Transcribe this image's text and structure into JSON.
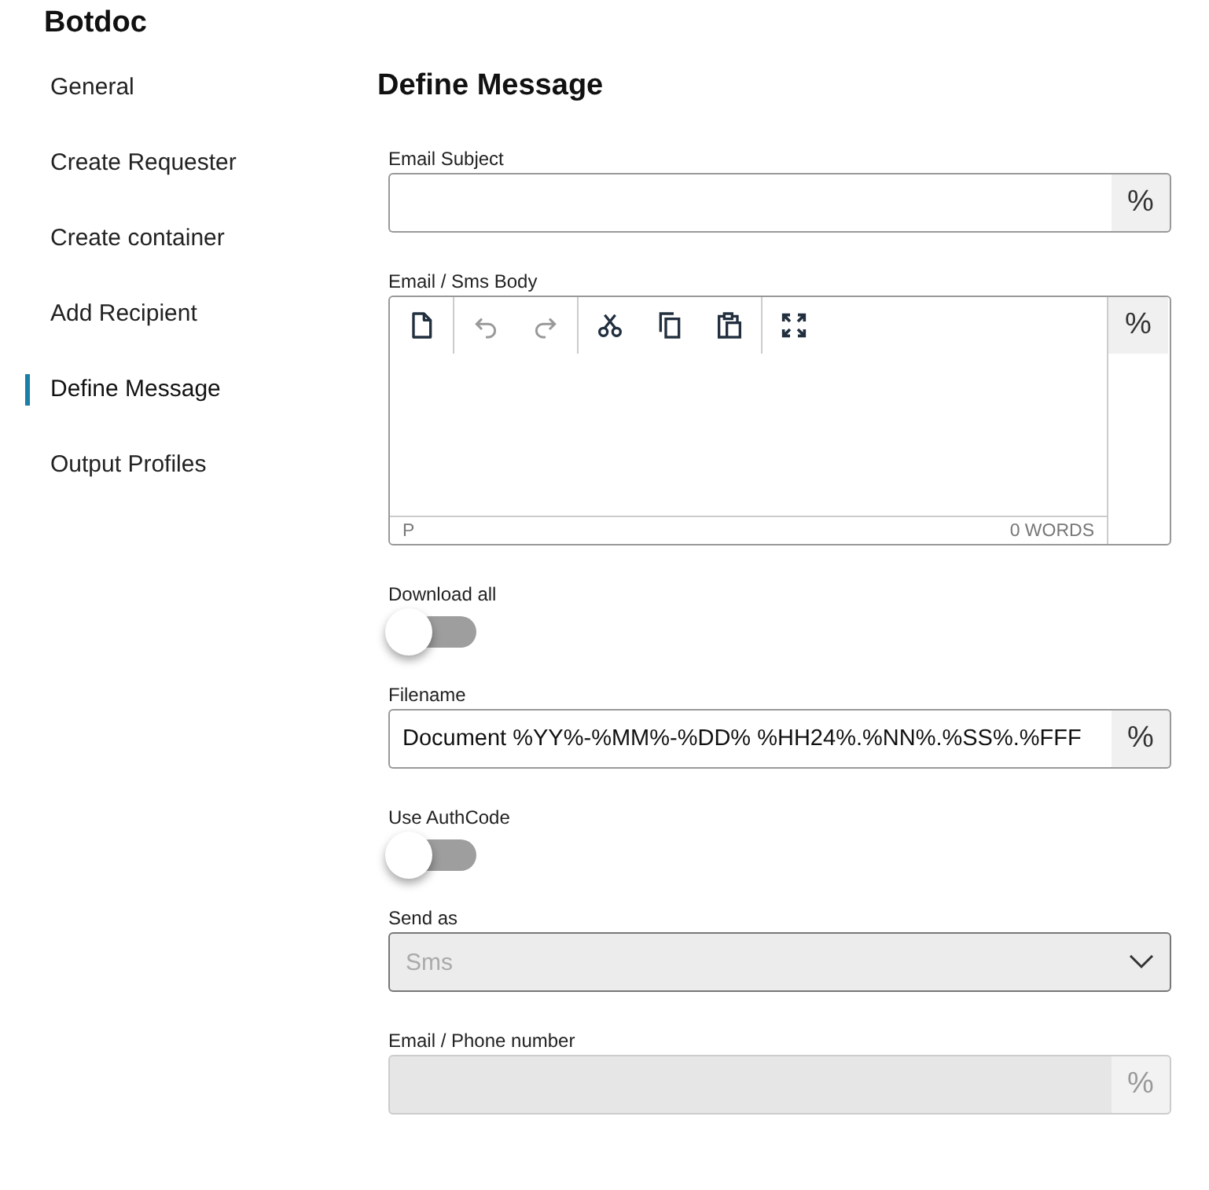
{
  "app": {
    "title": "Botdoc"
  },
  "sidebar": {
    "items": [
      {
        "label": "General",
        "selected": false
      },
      {
        "label": "Create Requester",
        "selected": false
      },
      {
        "label": "Create container",
        "selected": false
      },
      {
        "label": "Add Recipient",
        "selected": false
      },
      {
        "label": "Define Message",
        "selected": true
      },
      {
        "label": "Output Profiles",
        "selected": false
      }
    ]
  },
  "page": {
    "title": "Define Message"
  },
  "fields": [
    {
      "kind": "text",
      "label": "Email Subject",
      "button": "%",
      "disabled": false
    },
    {
      "kind": "editor",
      "label": "Email / Sms Body",
      "button": "%",
      "status_left": "P",
      "word_count": "0 WORDS",
      "toolbar_groups": [
        [
          {
            "kind": "document",
            "disabled": false
          }
        ],
        [
          {
            "kind": "undo",
            "disabled": true
          },
          {
            "kind": "redo",
            "disabled": true
          }
        ],
        [
          {
            "kind": "cut",
            "disabled": false
          },
          {
            "kind": "copy",
            "disabled": false
          },
          {
            "kind": "paste",
            "disabled": false
          }
        ],
        [
          {
            "kind": "fullscreen",
            "disabled": false
          }
        ]
      ]
    },
    {
      "kind": "toggle",
      "label": "Download all",
      "on": false
    },
    {
      "kind": "text",
      "label": "Filename",
      "value": "Document %YY%-%MM%-%DD% %HH24%.%NN%.%SS%.%FFF",
      "button": "%",
      "disabled": false
    },
    {
      "kind": "toggle",
      "label": "Use AuthCode",
      "on": false
    },
    {
      "kind": "select",
      "label": "Send as",
      "value": "Sms",
      "disabled": true
    },
    {
      "kind": "text",
      "label": "Email / Phone number",
      "button": "%",
      "disabled": true
    }
  ]
}
